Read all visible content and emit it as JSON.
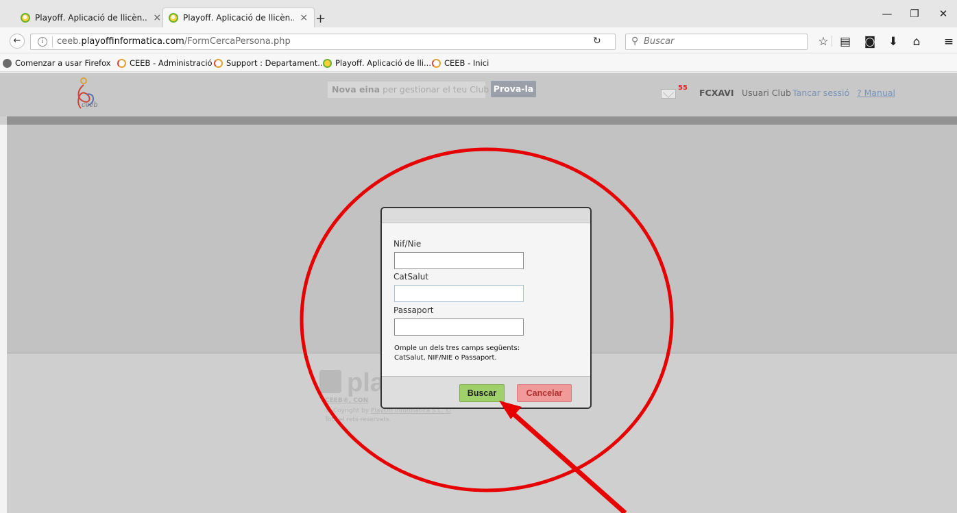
{
  "browser": {
    "tabs": [
      {
        "title": "Playoff. Aplicació de llicèn...",
        "active": false
      },
      {
        "title": "Playoff. Aplicació de llicèn...",
        "active": true
      }
    ],
    "tab_close_glyph": "×",
    "new_tab_glyph": "+",
    "window_controls": {
      "minimize": "—",
      "restore": "❐",
      "close": "✕"
    },
    "url_prefix": "ceeb.",
    "url_domain": "playoffinformatica.com",
    "url_path": "/FormCercaPersona.php",
    "search_placeholder": "Buscar",
    "bookmarks": [
      {
        "label": "Comenzar a usar Firefox",
        "icon": "globe-icon"
      },
      {
        "label": "CEEB - Administració",
        "icon": "ceeb-icon"
      },
      {
        "label": "Support : Departament...",
        "icon": "ceeb-icon"
      },
      {
        "label": "Playoff. Aplicació de lli...",
        "icon": "playoff-icon"
      },
      {
        "label": "CEEB - Inici",
        "icon": "ceeb-icon"
      }
    ]
  },
  "site_header": {
    "logo_text": "ceeb",
    "promo_bold": "Nova eina",
    "promo_rest": " per gestionar el teu Club",
    "prova_button": "Prova-la",
    "mail_count": "55",
    "club_code": "FCXAVI",
    "user_role": "Usuari Club",
    "logout": "Tancar sessió",
    "manual": "? Manual"
  },
  "modal": {
    "fields": [
      {
        "label": "Nif/Nie",
        "value": ""
      },
      {
        "label": "CatSalut",
        "value": ""
      },
      {
        "label": "Passaport",
        "value": ""
      }
    ],
    "help_line1": "Omple un dels tres camps següents:",
    "help_line2": "CatSalut, NIF/NIE o Passaport.",
    "search_button": "Buscar",
    "cancel_button": "Cancelar"
  },
  "footer": {
    "logo_text": "pla",
    "line1": "CEEB®, CON",
    "line2_prefix": "© Co",
    "line2_mid": "yright by ",
    "line2_link": "PlayOff Informàtica S.L. ©",
    "line3": "Tots el   rets reservats."
  },
  "colors": {
    "annotation": "#e60000",
    "search_button": "#9fd069",
    "cancel_button": "#f09a9a"
  }
}
